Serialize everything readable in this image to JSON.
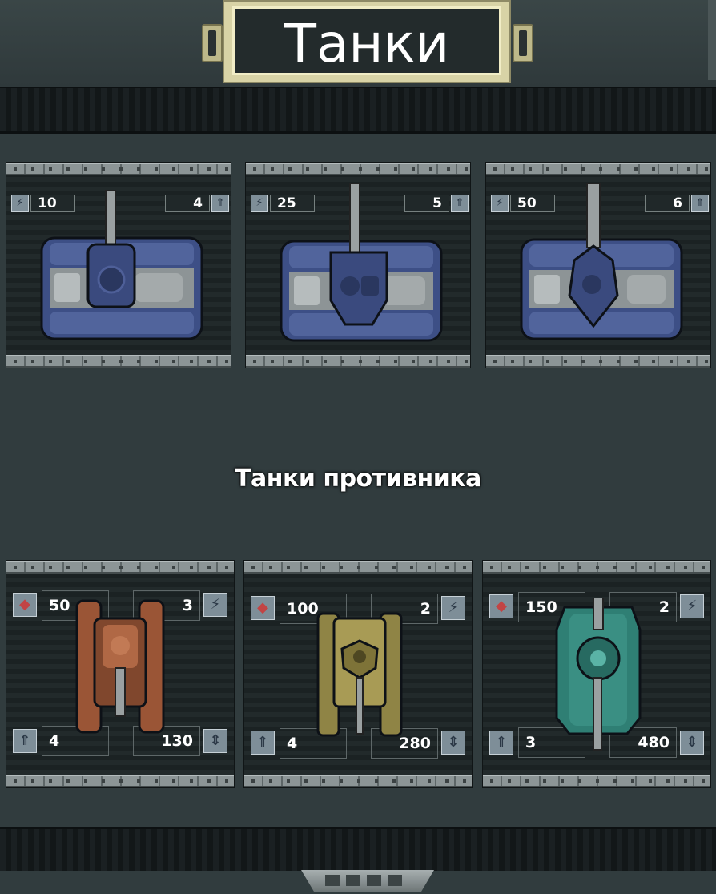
{
  "header": {
    "title": "Танки"
  },
  "player_tanks": [
    {
      "attack": "10",
      "level": "4",
      "body_color": "#3d4f86"
    },
    {
      "attack": "25",
      "level": "5",
      "body_color": "#3d4f86"
    },
    {
      "attack": "50",
      "level": "6",
      "body_color": "#3d4f86"
    }
  ],
  "section_title": "Танки противника",
  "enemy_tanks": [
    {
      "armor": "50",
      "attack": "3",
      "speed": "4",
      "health": "130",
      "body_color": "#9a5536"
    },
    {
      "armor": "100",
      "attack": "2",
      "speed": "4",
      "health": "280",
      "body_color": "#8f8445"
    },
    {
      "armor": "150",
      "attack": "2",
      "speed": "3",
      "health": "480",
      "body_color": "#2f7f74"
    }
  ],
  "icons": {
    "attack": "attack-icon",
    "level": "upgrade-arrow-icon",
    "armor": "shield-icon",
    "health": "health-arrows-icon"
  }
}
